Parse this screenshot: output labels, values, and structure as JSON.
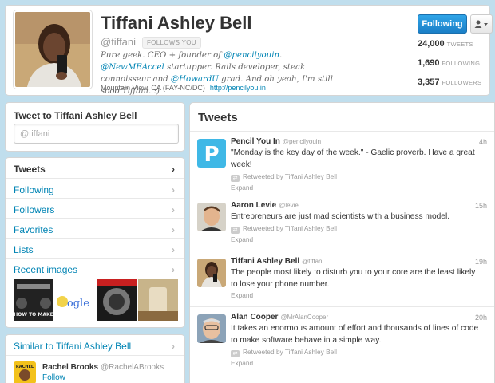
{
  "profile": {
    "name": "Tiffani Ashley Bell",
    "handle": "@tiffani",
    "follows_you": "FOLLOWS YOU",
    "bio": {
      "p1": "Pure geek. CEO + founder of ",
      "m1": "@pencilyouin",
      "p2": ". ",
      "m2": "@NewMEAccel",
      "p3": " startupper. Rails developer, steak connoisseur and ",
      "m3": "@HowardU",
      "p4": " grad. And oh yeah, I'm still sooo Tiffani. :)"
    },
    "location": "Mountain View, CA (FAY-NC/DC)",
    "url": "http://pencilyou.in",
    "following_button": "Following",
    "stats": [
      {
        "value": "24,000",
        "label": "TWEETS"
      },
      {
        "value": "1,690",
        "label": "FOLLOWING"
      },
      {
        "value": "3,357",
        "label": "FOLLOWERS"
      }
    ]
  },
  "compose": {
    "title": "Tweet to Tiffani Ashley Bell",
    "input_value": "@tiffani"
  },
  "nav": {
    "items": [
      {
        "label": "Tweets"
      },
      {
        "label": "Following"
      },
      {
        "label": "Followers"
      },
      {
        "label": "Favorites"
      },
      {
        "label": "Lists"
      },
      {
        "label": "Recent images"
      }
    ],
    "chevron": "›",
    "thumb_text": {
      "t1": "HOW TO MAKE",
      "t2": "oogle"
    }
  },
  "similar": {
    "title": "Similar to Tiffani Ashley Bell",
    "user": {
      "name": "Rachel Brooks",
      "handle": "@RachelABrooks",
      "follow": "Follow",
      "avatar_text": "RACHEL"
    }
  },
  "stream": {
    "title": "Tweets",
    "tweets": [
      {
        "name": "Pencil You In",
        "handle": "@pencilyouin",
        "time": "4h",
        "text": "\"Monday is the key day of the week.\" - Gaelic proverb. Have a great week!",
        "retweeted": "Retweeted by Tiffani Ashley Bell",
        "expand": "Expand",
        "avatar_letter": "P"
      },
      {
        "name": "Aaron Levie",
        "handle": "@levie",
        "time": "15h",
        "text": "Entrepreneurs are just mad scientists with a business model.",
        "retweeted": "Retweeted by Tiffani Ashley Bell",
        "expand": "Expand"
      },
      {
        "name": "Tiffani Ashley Bell",
        "handle": "@tiffani",
        "time": "19h",
        "text": "The people most likely to disturb you to your core are the least likely to lose your phone number.",
        "expand": "Expand"
      },
      {
        "name": "Alan Cooper",
        "handle": "@MrAlanCooper",
        "time": "20h",
        "text": "It takes an enormous amount of effort and thousands of lines of code to make software behave in a simple way.",
        "retweeted": "Retweeted by Tiffani Ashley Bell",
        "expand": "Expand"
      }
    ]
  },
  "colors": {
    "link": "#0084b4",
    "follow_button": "#1b7fc7",
    "background": "#c0deed"
  }
}
